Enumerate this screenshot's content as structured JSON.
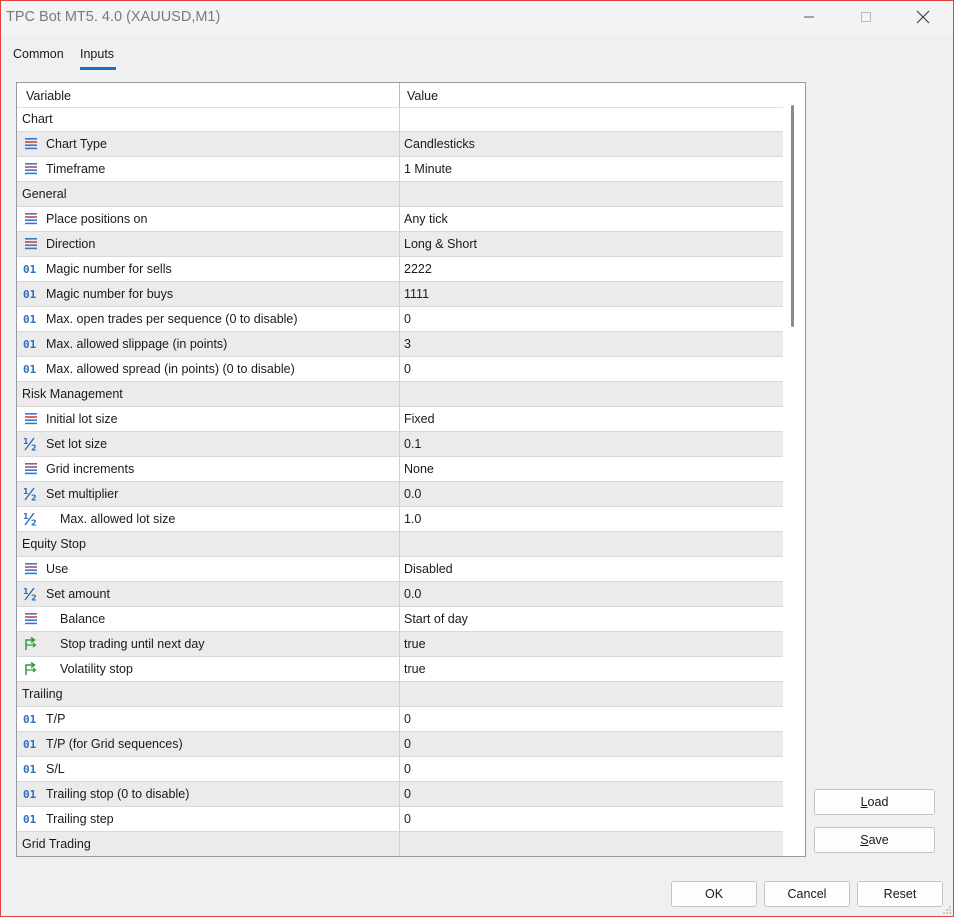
{
  "window": {
    "title": "TPC Bot MT5. 4.0 (XAUUSD,M1)"
  },
  "tabs": [
    {
      "label": "Common"
    },
    {
      "label": "Inputs"
    }
  ],
  "grid": {
    "col_variable": "Variable",
    "col_value": "Value",
    "rows": [
      {
        "type": "section",
        "label": "Chart",
        "value": ""
      },
      {
        "type": "enum",
        "label": "Chart Type",
        "value": "Candlesticks"
      },
      {
        "type": "enum",
        "label": "Timeframe",
        "value": "1 Minute"
      },
      {
        "type": "section",
        "label": "General",
        "value": ""
      },
      {
        "type": "enum",
        "label": "Place positions on",
        "value": "Any tick"
      },
      {
        "type": "enum",
        "label": "Direction",
        "value": "Long & Short"
      },
      {
        "type": "int",
        "label": "Magic number for sells",
        "value": "2222"
      },
      {
        "type": "int",
        "label": "Magic number for buys",
        "value": "1111"
      },
      {
        "type": "int",
        "label": "Max. open trades per sequence (0 to disable)",
        "value": "0"
      },
      {
        "type": "int",
        "label": "Max. allowed slippage (in points)",
        "value": "3"
      },
      {
        "type": "int",
        "label": "Max. allowed spread (in points) (0 to disable)",
        "value": "0"
      },
      {
        "type": "section",
        "label": "Risk Management",
        "value": ""
      },
      {
        "type": "enum",
        "label": "Initial lot size",
        "value": "Fixed"
      },
      {
        "type": "double",
        "label": "Set lot size",
        "value": "0.1"
      },
      {
        "type": "enum",
        "label": "Grid increments",
        "value": "None"
      },
      {
        "type": "double",
        "label": "Set multiplier",
        "value": "0.0"
      },
      {
        "type": "double",
        "label": "Max. allowed lot size",
        "value": "1.0",
        "indent": true
      },
      {
        "type": "section",
        "label": "Equity Stop",
        "value": ""
      },
      {
        "type": "enum",
        "label": "Use",
        "value": "Disabled"
      },
      {
        "type": "double",
        "label": "Set amount",
        "value": "0.0"
      },
      {
        "type": "enum",
        "label": "Balance",
        "value": "Start of day",
        "indent": true
      },
      {
        "type": "bool",
        "label": "Stop trading until next day",
        "value": "true",
        "indent": true
      },
      {
        "type": "bool",
        "label": "Volatility stop",
        "value": "true",
        "indent": true
      },
      {
        "type": "section",
        "label": "Trailing",
        "value": ""
      },
      {
        "type": "int",
        "label": "T/P",
        "value": "0"
      },
      {
        "type": "int",
        "label": "T/P (for Grid sequences)",
        "value": "0"
      },
      {
        "type": "int",
        "label": "S/L",
        "value": "0"
      },
      {
        "type": "int",
        "label": "Trailing stop (0 to disable)",
        "value": "0"
      },
      {
        "type": "int",
        "label": "Trailing step",
        "value": "0"
      },
      {
        "type": "section",
        "label": "Grid Trading",
        "value": ""
      }
    ]
  },
  "buttons": {
    "load": "Load",
    "save": "Save",
    "ok": "OK",
    "cancel": "Cancel",
    "reset": "Reset"
  },
  "icons": {
    "enum": "enum-list-icon",
    "int": "integer-icon",
    "double": "fraction-icon",
    "bool": "boolean-arrow-icon"
  },
  "colors": {
    "accent": "#1b6ec2",
    "window_border": "#e04040",
    "alt_row": "#ebebeb"
  }
}
